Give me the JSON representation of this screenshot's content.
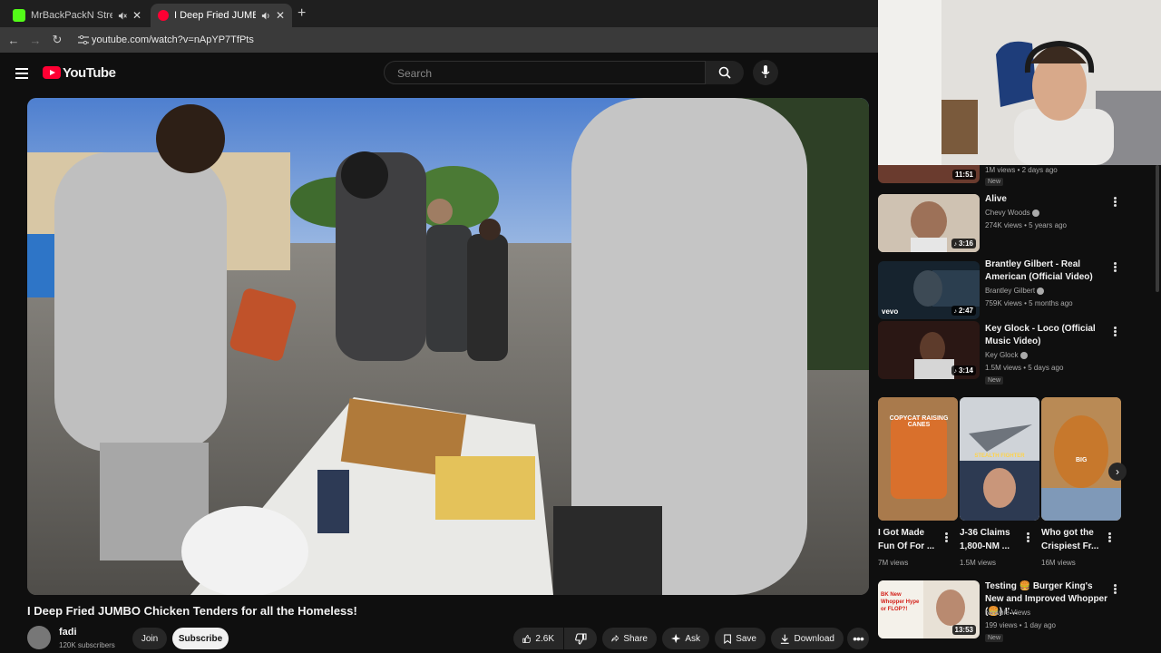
{
  "browser": {
    "tabs": [
      {
        "title": "MrBackPackN Stream - Wa",
        "active": false
      },
      {
        "title": "I Deep Fried JUMBO Chicke",
        "active": true
      }
    ],
    "new_tab": "+",
    "url": "youtube.com/watch?v=nApYP7TfPts"
  },
  "header": {
    "logo_text": "YouTube",
    "search_placeholder": "Search"
  },
  "video": {
    "title": "I Deep Fried JUMBO Chicken Tenders for all the Homeless!",
    "channel": "fadi",
    "subscribers": "120K subscribers",
    "join_label": "Join",
    "subscribe_label": "Subscribe",
    "likes": "2.6K",
    "share_label": "Share",
    "ask_label": "Ask",
    "save_label": "Save",
    "download_label": "Download"
  },
  "sidebar": {
    "top_partial": {
      "meta": "1M views • 2 days ago",
      "badge": "New",
      "duration": "11:51"
    },
    "items": [
      {
        "title": "Alive",
        "channel": "Chevy Woods",
        "meta": "274K views • 5 years ago",
        "duration": "3:16"
      },
      {
        "title": "Brantley Gilbert - Real American (Official Video)",
        "channel": "Brantley Gilbert",
        "meta": "759K views • 5 months ago",
        "duration": "2:47",
        "thumb_text": "vevo"
      },
      {
        "title": "Key Glock - Loco (Official Music Video)",
        "channel": "Key Glock",
        "meta": "1.5M views • 5 days ago",
        "badge": "New",
        "duration": "3:14"
      }
    ],
    "shorts": [
      {
        "title": "I Got Made Fun Of For ...",
        "views": "7M views",
        "thumb_text": "COPYCAT RAISING CANES"
      },
      {
        "title": "J-36 Claims 1,800-NM ...",
        "views": "1.5M views",
        "thumb_text": "STEALTH FIGHTER"
      },
      {
        "title": "Who got the Crispiest Fr...",
        "views": "16M views",
        "thumb_text": "BIG"
      }
    ],
    "bottom_item": {
      "title": "Testing 🍔 Burger King's New and Improved Whopper (🍔) I'...",
      "channel": "Newbie Views",
      "meta": "199 views • 1 day ago",
      "badge": "New",
      "duration": "13:53",
      "thumb_text": "BK New Whopper Hype or FLOP?!"
    }
  }
}
